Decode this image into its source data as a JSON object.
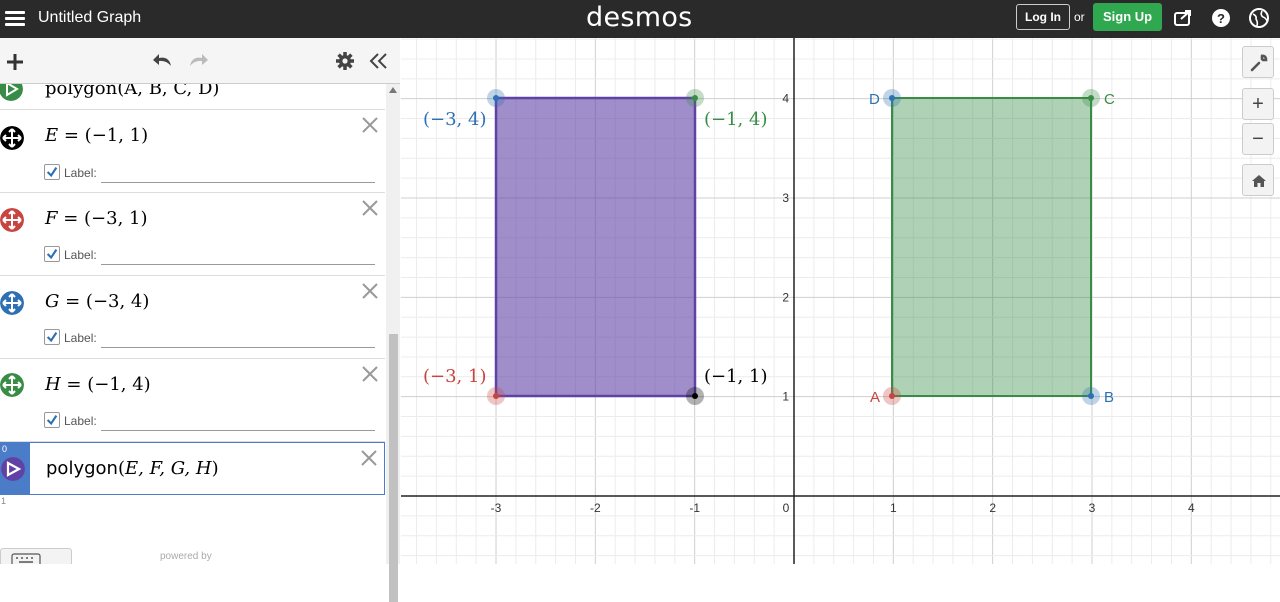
{
  "app": {
    "title": "Untitled Graph",
    "brand": "desmos",
    "login_label": "Log In",
    "or_label": "or",
    "signup_label": "Sign Up"
  },
  "colors": {
    "topbar": "#2a2a2a",
    "signup": "#2fa84f",
    "purple": "#6042a6",
    "green": "#388c46",
    "blue": "#2d70b3",
    "red": "#c74440",
    "black": "#000000"
  },
  "toolbar": {
    "icons": [
      "add-icon",
      "undo-icon",
      "redo-icon",
      "gear-icon",
      "collapse-icon"
    ]
  },
  "expressions": [
    {
      "index": "",
      "math": "polygon(A, B, C, D)",
      "color": "green",
      "icon": "polygon-icon"
    },
    {
      "index": "",
      "var": "E",
      "value": "(−1, 1)",
      "color": "black",
      "icon": "move-icon",
      "label_text": "Label:"
    },
    {
      "index": "",
      "var": "F",
      "value": "(−3, 1)",
      "color": "red",
      "icon": "move-icon",
      "label_text": "Label:"
    },
    {
      "index": "",
      "var": "G",
      "value": "(−3, 4)",
      "color": "blue",
      "icon": "move-icon",
      "label_text": "Label:"
    },
    {
      "index": "",
      "var": "H",
      "value": "(−1, 4)",
      "color": "green",
      "icon": "move-icon",
      "label_text": "Label:"
    },
    {
      "index": "0",
      "fn": "polygon",
      "args": "E, F, G, H",
      "color": "purple",
      "icon": "polygon-icon"
    },
    {
      "index": "1"
    }
  ],
  "footer": {
    "powered_by": "powered by"
  },
  "graph": {
    "x_ticks": [
      "-3",
      "-2",
      "-1",
      "0",
      "1",
      "2",
      "3",
      "4"
    ],
    "y_ticks": [
      "4",
      "3",
      "2",
      "1"
    ],
    "left_points": [
      {
        "label": "(−3, 4)",
        "color": "blue"
      },
      {
        "label": "(−1, 4)",
        "color": "green"
      },
      {
        "label": "(−3, 1)",
        "color": "red"
      },
      {
        "label": "(−1, 1)",
        "color": "black"
      }
    ],
    "right_points": [
      {
        "label": "D",
        "color": "blue"
      },
      {
        "label": "C",
        "color": "green"
      },
      {
        "label": "A",
        "color": "red"
      },
      {
        "label": "B",
        "color": "blue"
      }
    ]
  },
  "right_controls": {
    "icons": [
      "wrench-icon",
      "zoom-in-icon",
      "zoom-out-icon",
      "home-icon"
    ],
    "zoom_in": "+",
    "zoom_out": "−"
  }
}
